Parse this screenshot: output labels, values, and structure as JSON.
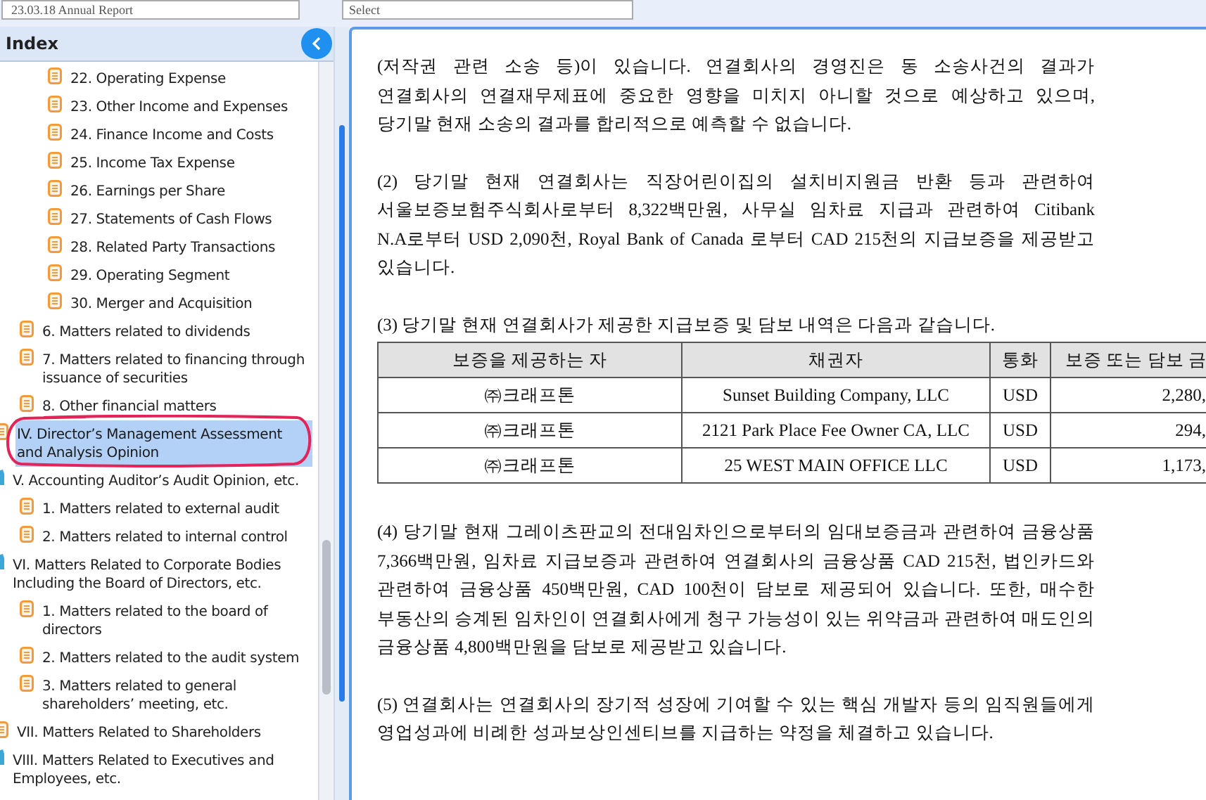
{
  "top_bar": {
    "report_select": "23.03.18  Annual Report",
    "section_select": "Select"
  },
  "index": {
    "title": "Index",
    "tree": [
      {
        "children": [
          {
            "children": [
              {
                "label": "22. Operating Expense",
                "kind": "doc",
                "selected": false
              },
              {
                "label": "23. Other Income and Expenses",
                "kind": "doc",
                "selected": false
              },
              {
                "label": "24. Finance Income and Costs",
                "kind": "doc",
                "selected": false
              },
              {
                "label": "25. Income Tax Expense",
                "kind": "doc",
                "selected": false
              },
              {
                "label": "26. Earnings per Share",
                "kind": "doc",
                "selected": false
              },
              {
                "label": "27. Statements of Cash Flows",
                "kind": "doc",
                "selected": false
              },
              {
                "label": "28. Related Party Transactions",
                "kind": "doc",
                "selected": false
              },
              {
                "label": "29. Operating Segment",
                "kind": "doc",
                "selected": false
              },
              {
                "label": "30. Merger and Acquisition",
                "kind": "doc",
                "selected": false
              }
            ]
          },
          {
            "label": "6. Matters related to dividends",
            "kind": "doc",
            "selected": false
          },
          {
            "label": "7. Matters related to financing through issuance of securities",
            "kind": "doc",
            "selected": false
          },
          {
            "label": "8. Other financial matters",
            "kind": "doc",
            "selected": false
          }
        ]
      },
      {
        "label": "IV. Director’s Management Assessment and Analysis Opinion",
        "kind": "doc",
        "selected": true
      },
      {
        "label": "V. Accounting Auditor’s Audit Opinion, etc.",
        "kind": "folder",
        "selected": false,
        "children": [
          {
            "label": "1. Matters related to external audit",
            "kind": "doc",
            "selected": false
          },
          {
            "label": "2. Matters related to internal control",
            "kind": "doc",
            "selected": false
          }
        ]
      },
      {
        "label": "VI. Matters Related to Corporate Bodies Including the Board of Directors, etc.",
        "kind": "folder",
        "selected": false,
        "children": [
          {
            "label": "1. Matters related to the board of directors",
            "kind": "doc",
            "selected": false
          },
          {
            "label": "2. Matters related to the audit system",
            "kind": "doc",
            "selected": false
          },
          {
            "label": "3. Matters related to general shareholders’ meeting, etc.",
            "kind": "doc",
            "selected": false
          }
        ]
      },
      {
        "label": "VII. Matters Related to Shareholders",
        "kind": "doc",
        "selected": false
      },
      {
        "label": "VIII. Matters Related to Executives and Employees, etc.",
        "kind": "folder",
        "selected": false
      }
    ]
  },
  "document": {
    "blocks": [
      {
        "kind": "paragraph",
        "text": "(저작권 관련 소송 등)이 있습니다. 연결회사의 경영진은 동 소송사건의 결과가 연결회사의 연결재무제표에 중요한 영향을 미치지 아니할 것으로 예상하고 있으며, 당기말 현재 소송의 결과를 합리적으로 예측할 수 없습니다."
      },
      {
        "kind": "paragraph",
        "text": "(2) 당기말 현재 연결회사는 직장어린이집의 설치비지원금 반환 등과 관련하여 서울보증보험주식회사로부터 8,322백만원, 사무실 임차료 지급과 관련하여 Citibank N.A로부터 USD 2,090천, Royal Bank of Canada 로부터 CAD 215천의 지급보증을 제공받고 있습니다."
      },
      {
        "kind": "paragraph",
        "text": "(3) 당기말 현재 연결회사가 제공한 지급보증 및 담보 내역은 다음과 같습니다."
      },
      {
        "kind": "table",
        "columns": [
          "보증을 제공하는 자",
          "채권자",
          "통화",
          "보증 또는 담보 금"
        ],
        "rows": [
          [
            "㈜크래프톤",
            "Sunset Building Company, LLC",
            "USD",
            "2,280,"
          ],
          [
            "㈜크래프톤",
            "2121 Park Place Fee Owner CA, LLC",
            "USD",
            "294,"
          ],
          [
            "㈜크래프톤",
            "25 WEST MAIN OFFICE LLC",
            "USD",
            "1,173,"
          ]
        ]
      },
      {
        "kind": "paragraph",
        "text": "(4) 당기말 현재 그레이츠판교의 전대임차인으로부터의 임대보증금과 관련하여 금융상품 7,366백만원, 임차료 지급보증과 관련하여 연결회사의 금융상품 CAD 215천, 법인카드와 관련하여 금융상품 450백만원, CAD 100천이 담보로 제공되어 있습니다. 또한, 매수한 부동산의 승계된 임차인이 연결회사에게 청구 가능성이 있는 위약금과 관련하여 매도인의 금융상품 4,800백만원을 담보로 제공받고 있습니다."
      },
      {
        "kind": "paragraph",
        "text": "(5) 연결회사는 연결회사의 장기적 성장에 기여할 수 있는 핵심 개발자 등의 임직원들에게 영업성과에 비례한 성과보상인센티브를 지급하는 약정을 체결하고 있습니다."
      }
    ]
  }
}
